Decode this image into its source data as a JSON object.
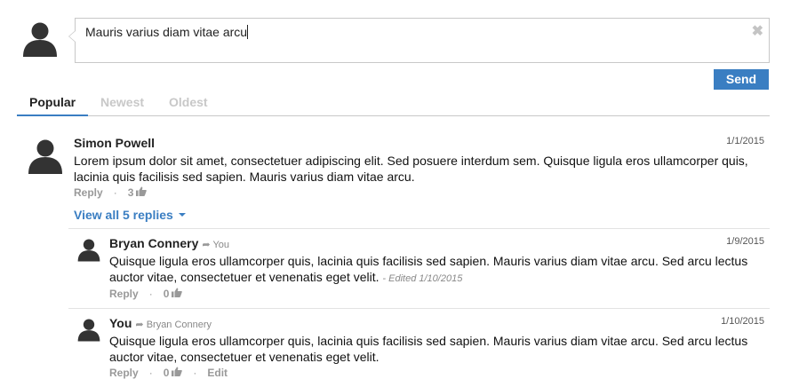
{
  "composer": {
    "value": "Mauris varius diam vitae arcu",
    "clear_icon": "✖",
    "send_label": "Send"
  },
  "tabs": [
    {
      "label": "Popular",
      "active": true
    },
    {
      "label": "Newest",
      "active": false
    },
    {
      "label": "Oldest",
      "active": false
    }
  ],
  "comment": {
    "author": "Simon Powell",
    "date": "1/1/2015",
    "text": "Lorem ipsum dolor sit amet, consectetuer adipiscing elit. Sed posuere interdum sem. Quisque ligula eros ullamcorper quis, lacinia quis facilisis sed sapien. Mauris varius diam vitae arcu.",
    "reply_label": "Reply",
    "likes": "3",
    "view_replies_label": "View all 5 replies"
  },
  "replies": [
    {
      "author": "Bryan Connery",
      "reply_to": "You",
      "date": "1/9/2015",
      "text": "Quisque ligula eros ullamcorper quis, lacinia quis facilisis sed sapien. Mauris varius diam vitae arcu. Sed arcu lectus auctor vitae, consectetuer et venenatis eget velit.",
      "edited": "- Edited 1/10/2015",
      "reply_label": "Reply",
      "likes": "0"
    },
    {
      "author": "You",
      "reply_to": "Bryan Connery",
      "date": "1/10/2015",
      "text": "Quisque ligula eros ullamcorper quis, lacinia quis facilisis sed sapien. Mauris varius diam vitae arcu. Sed arcu lectus auctor vitae, consectetuer et venenatis eget velit.",
      "reply_label": "Reply",
      "likes": "0",
      "edit_label": "Edit"
    }
  ],
  "colors": {
    "accent": "#3a7ec2",
    "avatar": "#333333",
    "muted": "#999999"
  },
  "icons": {
    "avatar": "user-silhouette-icon",
    "share": "share-arrow-icon",
    "like": "thumbs-up-icon",
    "clear": "close-icon"
  }
}
